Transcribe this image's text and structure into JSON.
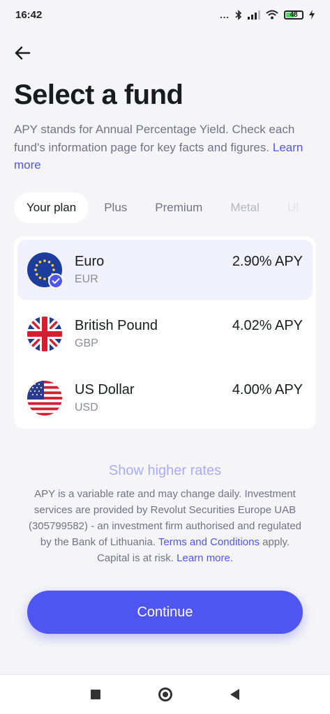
{
  "status_bar": {
    "time": "16:42",
    "dots": "...",
    "battery": "48",
    "icons": [
      "bluetooth-icon",
      "signal-icon",
      "wifi-icon",
      "battery-icon",
      "charging-icon"
    ]
  },
  "header": {
    "title": "Select a fund",
    "description": "APY stands for Annual Percentage Yield. Check each fund's information page for key facts and figures.",
    "learn_more": "Learn more"
  },
  "tabs": [
    {
      "label": "Your plan",
      "active": true
    },
    {
      "label": "Plus"
    },
    {
      "label": "Premium"
    },
    {
      "label": "Metal"
    },
    {
      "label": "Ul"
    }
  ],
  "funds": [
    {
      "name": "Euro",
      "code": "EUR",
      "apy": "2.90% APY",
      "flag": "eu-flag-icon",
      "selected": true
    },
    {
      "name": "British Pound",
      "code": "GBP",
      "apy": "4.02% APY",
      "flag": "uk-flag-icon"
    },
    {
      "name": "US Dollar",
      "code": "USD",
      "apy": "4.00% APY",
      "flag": "us-flag-icon"
    }
  ],
  "show_higher_rates": "Show higher rates",
  "disclaimer": {
    "text_1": "APY is a variable rate and may change daily. Investment services are provided by Revolut Securities Europe UAB (305799582) - an investment firm authorised and regulated by the Bank of Lithuania.",
    "terms_link": "Terms and Conditions",
    "text_2": "apply. Capital is at risk.",
    "learn_more": "Learn more",
    "period": "."
  },
  "continue_label": "Continue",
  "colors": {
    "accent": "#4f55f1",
    "background": "#f5f5f7",
    "muted_text": "#717386"
  }
}
